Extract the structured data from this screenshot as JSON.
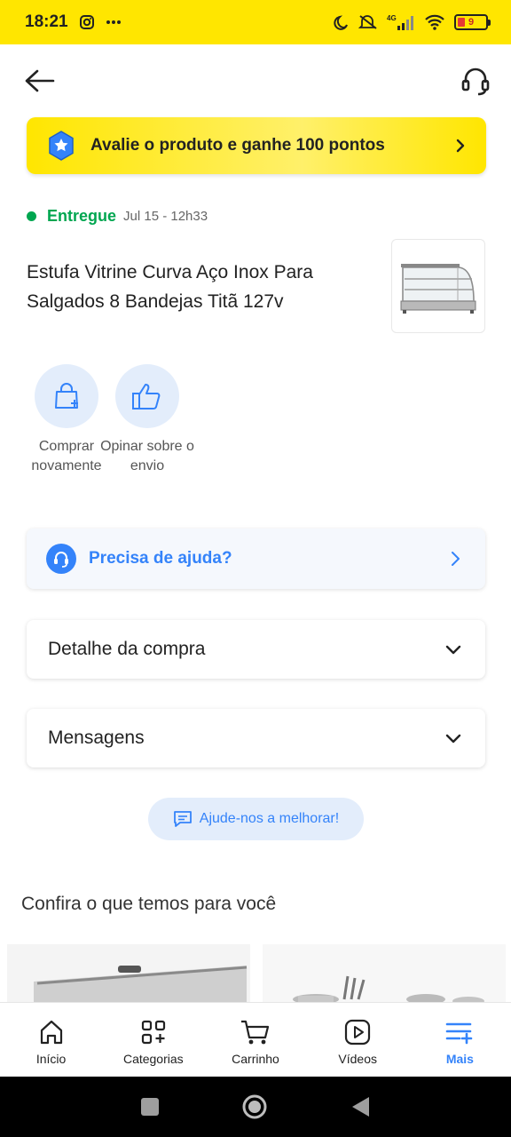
{
  "status_bar": {
    "time": "18:21",
    "network": "4G",
    "battery": "9"
  },
  "promo": {
    "text": "Avalie o produto e ganhe 100 pontos"
  },
  "order": {
    "status": "Entregue",
    "date": "Jul 15 - 12h33",
    "product_title": "Estufa Vitrine Curva Aço Inox Para Salgados 8 Bandejas Titã 127v"
  },
  "actions": [
    {
      "label": "Comprar novamente",
      "icon": "bag-plus-icon"
    },
    {
      "label": "Opinar sobre o envio",
      "icon": "thumbs-up-icon"
    }
  ],
  "help": {
    "text": "Precisa de ajuda?"
  },
  "accordions": [
    {
      "title": "Detalhe da compra"
    },
    {
      "title": "Mensagens"
    }
  ],
  "feedback": {
    "text": "Ajude-nos a melhorar!"
  },
  "recommend": {
    "title": "Confira o que temos para você"
  },
  "nav": [
    {
      "label": "Início",
      "icon": "home-icon"
    },
    {
      "label": "Categorias",
      "icon": "categories-icon"
    },
    {
      "label": "Carrinho",
      "icon": "cart-icon"
    },
    {
      "label": "Vídeos",
      "icon": "video-icon"
    },
    {
      "label": "Mais",
      "icon": "menu-plus-icon",
      "active": true
    }
  ],
  "colors": {
    "brand_yellow": "#ffe600",
    "accent_blue": "#3483fa",
    "success_green": "#00a650"
  }
}
